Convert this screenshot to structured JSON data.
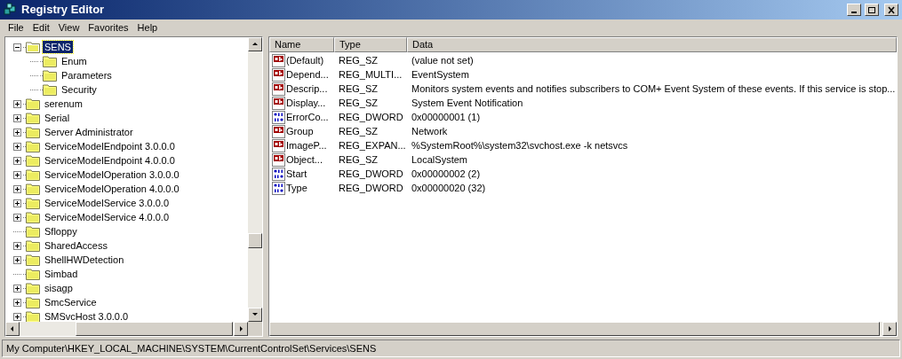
{
  "window": {
    "title": "Registry Editor"
  },
  "menu": [
    "File",
    "Edit",
    "View",
    "Favorites",
    "Help"
  ],
  "tree": [
    {
      "label": "SENS",
      "selected": true,
      "expanded": true,
      "children": [
        {
          "label": "Enum",
          "selected": false
        },
        {
          "label": "Parameters",
          "selected": false
        },
        {
          "label": "Security",
          "selected": false
        }
      ]
    },
    {
      "label": "serenum",
      "selected": false,
      "expanded": false
    },
    {
      "label": "Serial",
      "selected": false,
      "expanded": false
    },
    {
      "label": "Server Administrator",
      "selected": false,
      "expanded": false
    },
    {
      "label": "ServiceModelEndpoint 3.0.0.0",
      "selected": false,
      "expanded": false
    },
    {
      "label": "ServiceModelEndpoint 4.0.0.0",
      "selected": false,
      "expanded": false
    },
    {
      "label": "ServiceModelOperation 3.0.0.0",
      "selected": false,
      "expanded": false
    },
    {
      "label": "ServiceModelOperation 4.0.0.0",
      "selected": false,
      "expanded": false
    },
    {
      "label": "ServiceModelService 3.0.0.0",
      "selected": false,
      "expanded": false
    },
    {
      "label": "ServiceModelService 4.0.0.0",
      "selected": false,
      "expanded": false
    },
    {
      "label": "Sfloppy",
      "selected": false
    },
    {
      "label": "SharedAccess",
      "selected": false,
      "expanded": false
    },
    {
      "label": "ShellHWDetection",
      "selected": false,
      "expanded": false
    },
    {
      "label": "Simbad",
      "selected": false
    },
    {
      "label": "sisagp",
      "selected": false,
      "expanded": false
    },
    {
      "label": "SmcService",
      "selected": false,
      "expanded": false
    },
    {
      "label": "SMSvcHost 3.0.0.0",
      "selected": false,
      "expanded": false
    }
  ],
  "table": {
    "columns": [
      "Name",
      "Type",
      "Data"
    ],
    "rows": [
      {
        "kind": "string",
        "name": "(Default)",
        "type": "REG_SZ",
        "data": "(value not set)"
      },
      {
        "kind": "string",
        "name": "Depend...",
        "type": "REG_MULTI...",
        "data": "EventSystem"
      },
      {
        "kind": "string",
        "name": "Descrip...",
        "type": "REG_SZ",
        "data": "Monitors system events and notifies subscribers to COM+ Event System of these events. If this service is stop..."
      },
      {
        "kind": "string",
        "name": "Display...",
        "type": "REG_SZ",
        "data": "System Event Notification"
      },
      {
        "kind": "binary",
        "name": "ErrorCo...",
        "type": "REG_DWORD",
        "data": "0x00000001 (1)"
      },
      {
        "kind": "string",
        "name": "Group",
        "type": "REG_SZ",
        "data": "Network"
      },
      {
        "kind": "string",
        "name": "ImageP...",
        "type": "REG_EXPAN...",
        "data": "%SystemRoot%\\system32\\svchost.exe -k netsvcs"
      },
      {
        "kind": "string",
        "name": "Object...",
        "type": "REG_SZ",
        "data": "LocalSystem"
      },
      {
        "kind": "binary",
        "name": "Start",
        "type": "REG_DWORD",
        "data": "0x00000002 (2)"
      },
      {
        "kind": "binary",
        "name": "Type",
        "type": "REG_DWORD",
        "data": "0x00000020 (32)"
      }
    ]
  },
  "status_bar": "My Computer\\HKEY_LOCAL_MACHINE\\SYSTEM\\CurrentControlSet\\Services\\SENS"
}
